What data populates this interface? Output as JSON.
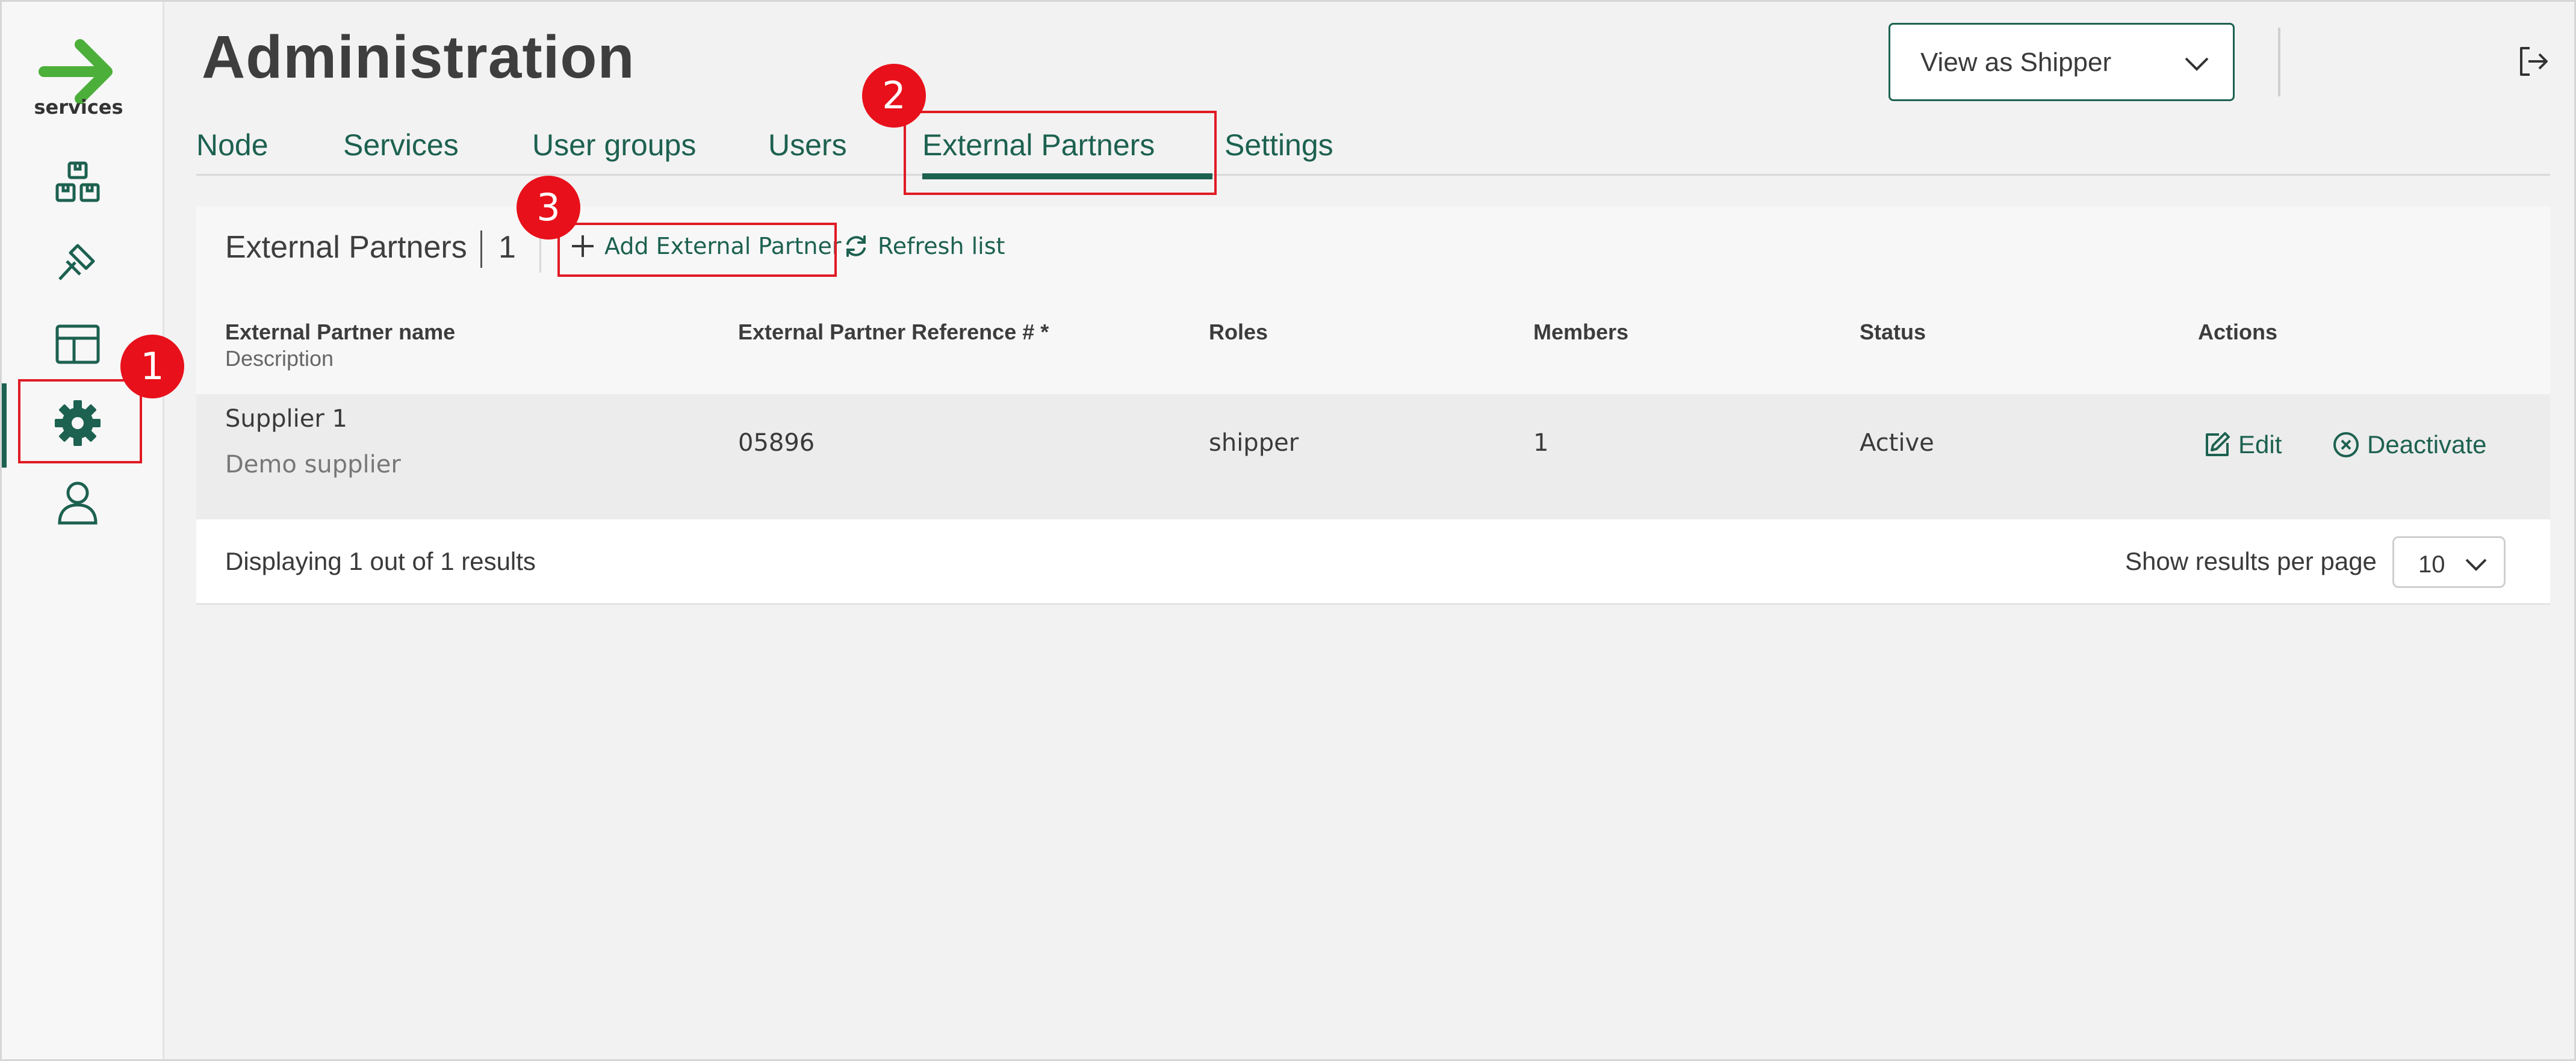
{
  "brand": {
    "logo_text": "services",
    "logo_color": "#4caf3a"
  },
  "accent_color": "#1d6150",
  "sidebar": {
    "items": [
      {
        "name": "boxes-icon",
        "active": false
      },
      {
        "name": "gavel-icon",
        "active": false
      },
      {
        "name": "layout-icon",
        "active": false
      },
      {
        "name": "gear-icon",
        "active": true
      },
      {
        "name": "user-icon",
        "active": false
      }
    ]
  },
  "header": {
    "title": "Administration",
    "view_select": {
      "value": "View as Shipper"
    }
  },
  "tabs": [
    {
      "label": "Node"
    },
    {
      "label": "Services"
    },
    {
      "label": "User groups"
    },
    {
      "label": "Users"
    },
    {
      "label": "External Partners",
      "active": true
    },
    {
      "label": "Settings"
    }
  ],
  "panel": {
    "title": "External Partners",
    "count": "1",
    "add_label": "Add External Partner",
    "refresh_label": "Refresh list"
  },
  "table": {
    "columns": {
      "name": "External Partner name",
      "name_sub": "Description",
      "reference": "External Partner Reference # *",
      "roles": "Roles",
      "members": "Members",
      "status": "Status",
      "actions": "Actions"
    },
    "rows": [
      {
        "name": "Supplier 1",
        "description": "Demo supplier",
        "reference": "05896",
        "roles": "shipper",
        "members": "1",
        "status": "Active",
        "edit_label": "Edit",
        "deactivate_label": "Deactivate"
      }
    ]
  },
  "footer": {
    "results_text": "Displaying 1 out of 1 results",
    "per_page_label": "Show results per page",
    "per_page_value": "10"
  },
  "annotations": [
    {
      "number": "1"
    },
    {
      "number": "2"
    },
    {
      "number": "3"
    }
  ]
}
